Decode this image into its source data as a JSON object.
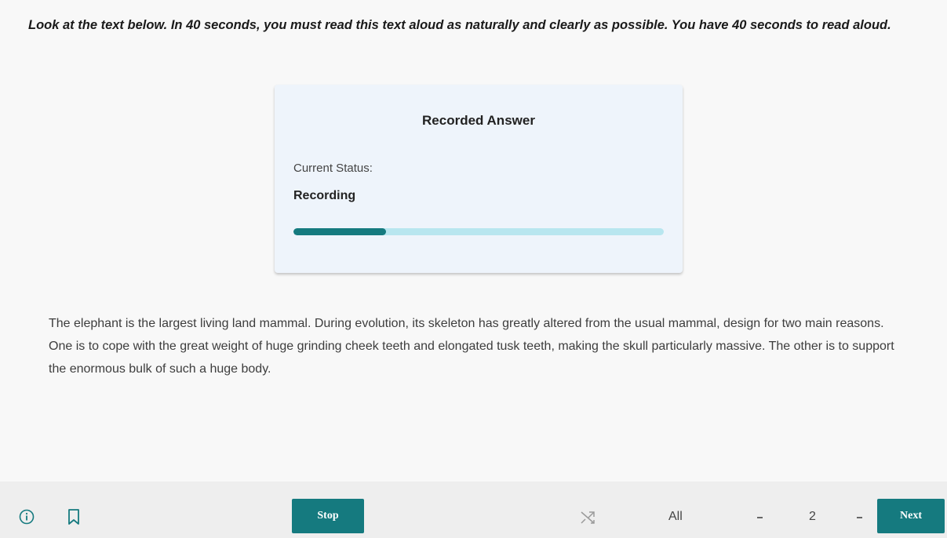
{
  "instructions": "Look at the text below. In 40 seconds, you must read this text aloud as naturally and clearly as possible. You have 40 seconds to read aloud.",
  "recorder": {
    "title": "Recorded Answer",
    "status_label": "Current Status:",
    "status_value": "Recording",
    "progress_fraction": 0.25
  },
  "passage": "The elephant is the largest living land mammal. During evolution, its skeleton has greatly altered from the usual mammal, design for two main reasons. One is to cope with the great weight of huge grinding cheek teeth and elongated tusk teeth, making the skull particularly massive. The other is to support the enormous bulk of such a huge body.",
  "toolbar": {
    "stop_label": "Stop",
    "filter_value": "All",
    "page_value": "2",
    "next_label": "Next"
  },
  "icons": {
    "info": "info-icon",
    "bookmark": "bookmark-icon",
    "shuffle": "shuffle-icon"
  },
  "colors": {
    "accent": "#157a7f",
    "progress_track": "#b8e6ef",
    "card_background": "#eef4fb"
  }
}
